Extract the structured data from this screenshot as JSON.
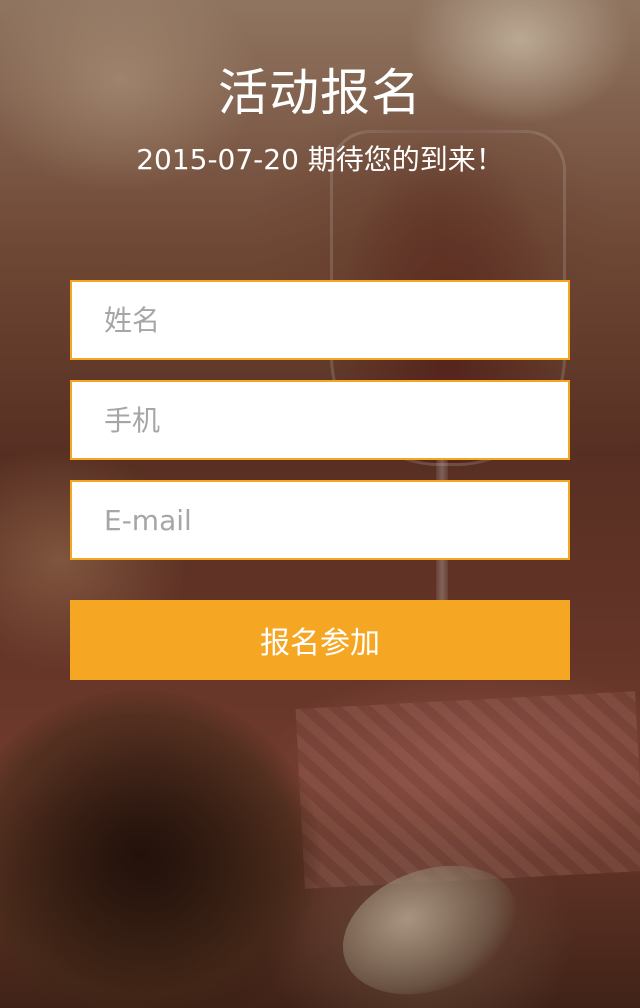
{
  "header": {
    "title": "活动报名",
    "subtitle": "2015-07-20 期待您的到来！"
  },
  "form": {
    "name_placeholder": "姓名",
    "phone_placeholder": "手机",
    "email_placeholder": "E-mail",
    "submit_label": "报名参加"
  },
  "colors": {
    "accent": "#f5a623",
    "field_background": "#ffffff",
    "placeholder": "#a6a6a6",
    "title_text": "#ffffff"
  }
}
